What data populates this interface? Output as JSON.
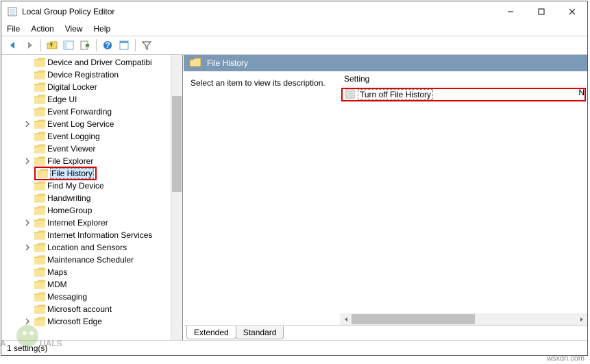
{
  "window": {
    "title": "Local Group Policy Editor"
  },
  "menu": {
    "file": "File",
    "action": "Action",
    "view": "View",
    "help": "Help"
  },
  "tree": {
    "items": [
      {
        "label": "Device and Driver Compatibi",
        "exp": false
      },
      {
        "label": "Device Registration",
        "exp": false
      },
      {
        "label": "Digital Locker",
        "exp": false
      },
      {
        "label": "Edge UI",
        "exp": false
      },
      {
        "label": "Event Forwarding",
        "exp": false
      },
      {
        "label": "Event Log Service",
        "exp": true
      },
      {
        "label": "Event Logging",
        "exp": false
      },
      {
        "label": "Event Viewer",
        "exp": false
      },
      {
        "label": "File Explorer",
        "exp": true
      },
      {
        "label": "File History",
        "exp": false,
        "selected": true,
        "hl": true
      },
      {
        "label": "Find My Device",
        "exp": false
      },
      {
        "label": "Handwriting",
        "exp": false
      },
      {
        "label": "HomeGroup",
        "exp": false
      },
      {
        "label": "Internet Explorer",
        "exp": true
      },
      {
        "label": "Internet Information Services",
        "exp": false
      },
      {
        "label": "Location and Sensors",
        "exp": true
      },
      {
        "label": "Maintenance Scheduler",
        "exp": false
      },
      {
        "label": "Maps",
        "exp": false
      },
      {
        "label": "MDM",
        "exp": false
      },
      {
        "label": "Messaging",
        "exp": false
      },
      {
        "label": "Microsoft account",
        "exp": false
      },
      {
        "label": "Microsoft Edge",
        "exp": true
      }
    ]
  },
  "right": {
    "header": "File History",
    "desc": "Select an item to view its description.",
    "col": "Setting",
    "item": "Turn off File History",
    "state": "N"
  },
  "tabs": {
    "extended": "Extended",
    "standard": "Standard"
  },
  "status": "1 setting(s)",
  "watermark": "wsxdn.com"
}
